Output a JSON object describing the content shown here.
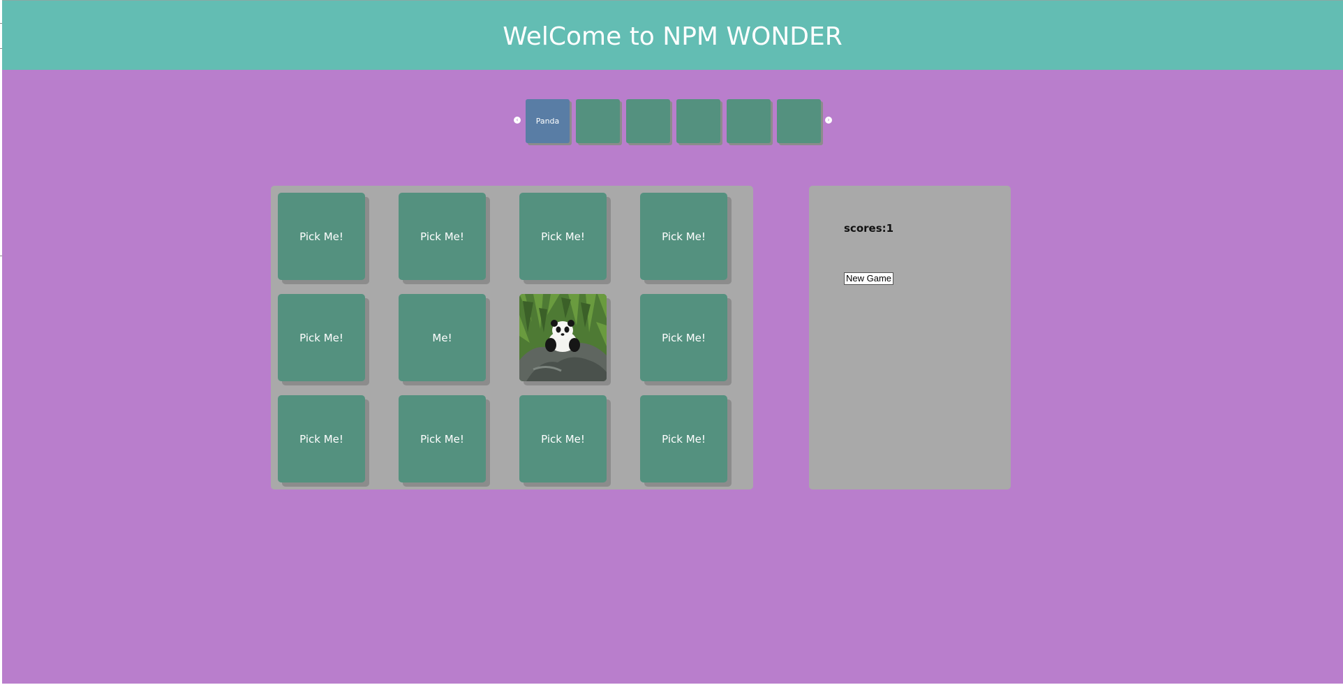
{
  "header": {
    "title": "WelCome to NPM WONDER"
  },
  "carousel": {
    "prev_icon": "chevron-left-icon",
    "next_icon": "chevron-right-icon",
    "thumbs": [
      {
        "label": "Panda",
        "active": true
      },
      {
        "label": "",
        "active": false
      },
      {
        "label": "",
        "active": false
      },
      {
        "label": "",
        "active": false
      },
      {
        "label": "",
        "active": false
      },
      {
        "label": "",
        "active": false
      }
    ]
  },
  "board": {
    "cards": [
      {
        "label": "Pick Me!",
        "revealed": false
      },
      {
        "label": "Pick Me!",
        "revealed": false
      },
      {
        "label": "Pick Me!",
        "revealed": false
      },
      {
        "label": "Pick Me!",
        "revealed": false
      },
      {
        "label": "Pick Me!",
        "revealed": false
      },
      {
        "label": "Me!",
        "revealed": false
      },
      {
        "label": "",
        "revealed": true,
        "image": "panda-image"
      },
      {
        "label": "Pick Me!",
        "revealed": false
      },
      {
        "label": "Pick Me!",
        "revealed": false
      },
      {
        "label": "Pick Me!",
        "revealed": false
      },
      {
        "label": "Pick Me!",
        "revealed": false
      },
      {
        "label": "Pick Me!",
        "revealed": false
      }
    ]
  },
  "panel": {
    "score_text": "scores:1",
    "new_game_label": "New Game"
  },
  "colors": {
    "background": "#b97ecc",
    "header": "#63bdb3",
    "card": "#54917f",
    "active_thumb": "#597da5",
    "board": "#a9a9a9"
  }
}
